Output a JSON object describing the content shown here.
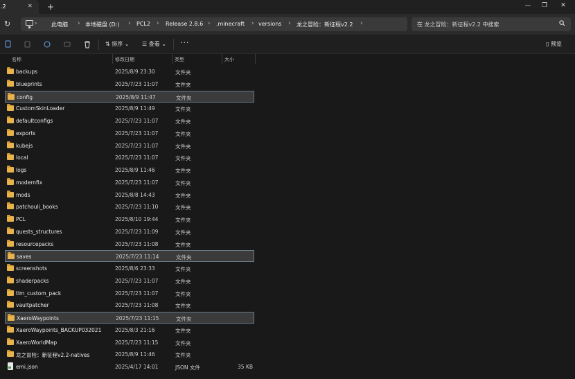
{
  "window": {
    "tab_label": ".2",
    "tab_close": "✕",
    "new_tab": "+",
    "minimize": "—",
    "maximize": "❐",
    "close": "✕"
  },
  "address": {
    "crumbs": [
      "此电脑",
      "本地磁盘 (D:)",
      "PCL2",
      "Release 2.8.6",
      ".minecraft",
      "versions",
      "龙之冒险：新征程v2.2"
    ],
    "separator": "›",
    "search_placeholder": "在 龙之冒险：新征程v2.2 中搜索"
  },
  "toolbar": {
    "sort_label": "排序",
    "view_label": "查看",
    "more_label": "···",
    "preview_label": "预览"
  },
  "columns": {
    "name": "名称",
    "modified": "修改日期",
    "type": "类型",
    "size": "大小"
  },
  "files": [
    {
      "name": "backups",
      "modified": "2025/8/9 23:30",
      "type": "文件夹",
      "size": "",
      "kind": "folder",
      "selected": false
    },
    {
      "name": "blueprints",
      "modified": "2025/7/23 11:07",
      "type": "文件夹",
      "size": "",
      "kind": "folder",
      "selected": false
    },
    {
      "name": "config",
      "modified": "2025/8/9 11:47",
      "type": "文件夹",
      "size": "",
      "kind": "folder",
      "selected": true
    },
    {
      "name": "CustomSkinLoader",
      "modified": "2025/8/9 11:49",
      "type": "文件夹",
      "size": "",
      "kind": "folder",
      "selected": false
    },
    {
      "name": "defaultconfigs",
      "modified": "2025/7/23 11:07",
      "type": "文件夹",
      "size": "",
      "kind": "folder",
      "selected": false
    },
    {
      "name": "exports",
      "modified": "2025/7/23 11:07",
      "type": "文件夹",
      "size": "",
      "kind": "folder",
      "selected": false
    },
    {
      "name": "kubejs",
      "modified": "2025/7/23 11:07",
      "type": "文件夹",
      "size": "",
      "kind": "folder",
      "selected": false
    },
    {
      "name": "local",
      "modified": "2025/7/23 11:07",
      "type": "文件夹",
      "size": "",
      "kind": "folder",
      "selected": false
    },
    {
      "name": "logs",
      "modified": "2025/8/9 11:46",
      "type": "文件夹",
      "size": "",
      "kind": "folder",
      "selected": false
    },
    {
      "name": "modernfix",
      "modified": "2025/7/23 11:07",
      "type": "文件夹",
      "size": "",
      "kind": "folder",
      "selected": false
    },
    {
      "name": "mods",
      "modified": "2025/8/8 14:43",
      "type": "文件夹",
      "size": "",
      "kind": "folder",
      "selected": false
    },
    {
      "name": "patchouli_books",
      "modified": "2025/7/23 11:10",
      "type": "文件夹",
      "size": "",
      "kind": "folder",
      "selected": false
    },
    {
      "name": "PCL",
      "modified": "2025/8/10 19:44",
      "type": "文件夹",
      "size": "",
      "kind": "folder",
      "selected": false
    },
    {
      "name": "quests_structures",
      "modified": "2025/7/23 11:09",
      "type": "文件夹",
      "size": "",
      "kind": "folder",
      "selected": false
    },
    {
      "name": "resourcepacks",
      "modified": "2025/7/23 11:08",
      "type": "文件夹",
      "size": "",
      "kind": "folder",
      "selected": false
    },
    {
      "name": "saves",
      "modified": "2025/7/23 11:14",
      "type": "文件夹",
      "size": "",
      "kind": "folder",
      "selected": true
    },
    {
      "name": "screenshots",
      "modified": "2025/8/6 23:33",
      "type": "文件夹",
      "size": "",
      "kind": "folder",
      "selected": false
    },
    {
      "name": "shaderpacks",
      "modified": "2025/7/23 11:07",
      "type": "文件夹",
      "size": "",
      "kind": "folder",
      "selected": false
    },
    {
      "name": "tlm_custom_pack",
      "modified": "2025/7/23 11:07",
      "type": "文件夹",
      "size": "",
      "kind": "folder",
      "selected": false
    },
    {
      "name": "vaultpatcher",
      "modified": "2025/7/23 11:08",
      "type": "文件夹",
      "size": "",
      "kind": "folder",
      "selected": false
    },
    {
      "name": "XaeroWaypoints",
      "modified": "2025/7/23 11:15",
      "type": "文件夹",
      "size": "",
      "kind": "folder",
      "selected": true
    },
    {
      "name": "XaeroWaypoints_BACKUP032021",
      "modified": "2025/8/3 21:16",
      "type": "文件夹",
      "size": "",
      "kind": "folder",
      "selected": false
    },
    {
      "name": "XaeroWorldMap",
      "modified": "2025/7/23 11:15",
      "type": "文件夹",
      "size": "",
      "kind": "folder",
      "selected": false
    },
    {
      "name": "龙之冒险：新征程v2.2-natives",
      "modified": "2025/8/9 11:46",
      "type": "文件夹",
      "size": "",
      "kind": "folder",
      "selected": false
    },
    {
      "name": "emi.json",
      "modified": "2025/4/17 14:01",
      "type": "JSON 文件",
      "size": "35 KB",
      "kind": "file",
      "selected": false
    }
  ]
}
